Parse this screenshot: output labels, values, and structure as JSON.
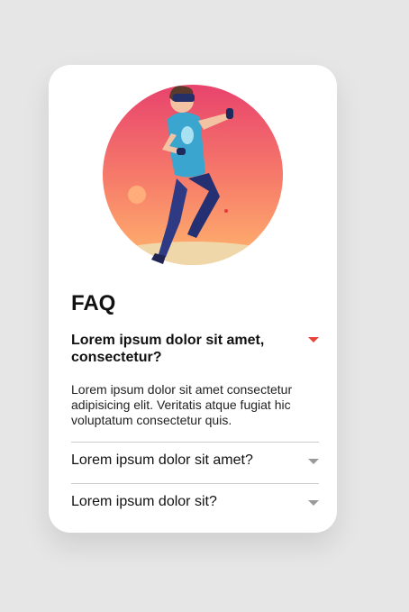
{
  "faq": {
    "title": "FAQ",
    "items": [
      {
        "question": "Lorem ipsum dolor sit amet, consectetur?",
        "answer": "Lorem ipsum dolor sit amet consectetur adipisicing elit. Veritatis atque fugiat hic voluptatum consectetur quis.",
        "expanded": true
      },
      {
        "question": "Lorem ipsum dolor sit amet?",
        "expanded": false
      },
      {
        "question": "Lorem ipsum dolor sit?",
        "expanded": false
      }
    ]
  },
  "colors": {
    "page_background": "#e6e6e6",
    "card_background": "#ffffff",
    "accent_caret": "#e8443a",
    "muted_caret": "#9a9a9a",
    "gradient_top": "#e8436d",
    "gradient_bottom": "#ffb26b"
  },
  "icons": {
    "expanded_caret": "caret-down-icon",
    "collapsed_caret": "caret-down-icon"
  }
}
